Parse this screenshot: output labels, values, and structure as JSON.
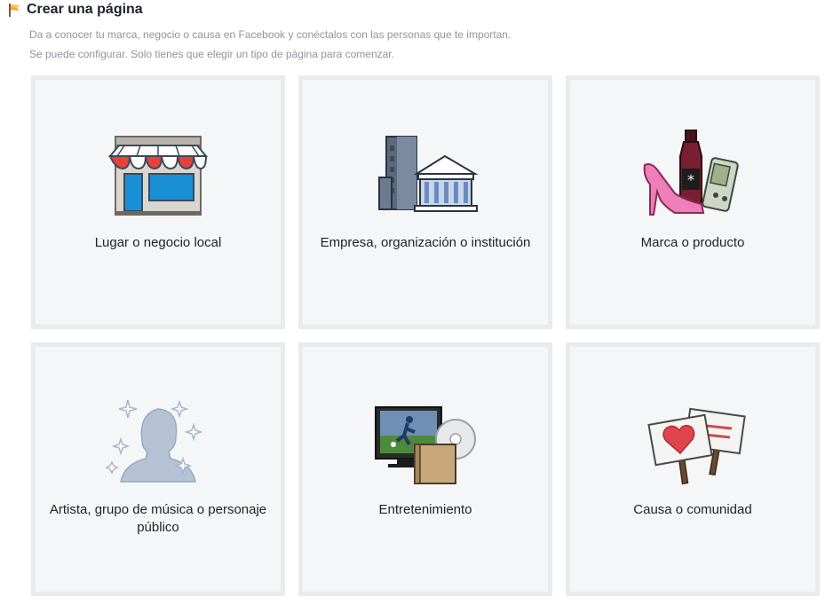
{
  "header": {
    "icon": "orange-flag-icon",
    "title": "Crear una página",
    "description_line1": "Da a conocer tu marca, negocio o causa en Facebook y conéctalos con las personas que te importan.",
    "description_line2": "Se puede configurar. Solo tienes que elegir un tipo de página para comenzar."
  },
  "categories": [
    {
      "label": "Lugar o negocio local",
      "icon": "storefront-icon"
    },
    {
      "label": "Empresa, organización o institución",
      "icon": "buildings-icon"
    },
    {
      "label": "Marca o producto",
      "icon": "products-icon"
    },
    {
      "label": "Artista, grupo de música o personaje público",
      "icon": "public-figure-icon"
    },
    {
      "label": "Entretenimiento",
      "icon": "entertainment-icon"
    },
    {
      "label": "Causa o comunidad",
      "icon": "protest-signs-icon"
    }
  ],
  "colors": {
    "tile_border": "#e9ebee",
    "tile_background": "#f5f6f7",
    "title_text": "#1d2129",
    "description_text": "#90949c"
  }
}
